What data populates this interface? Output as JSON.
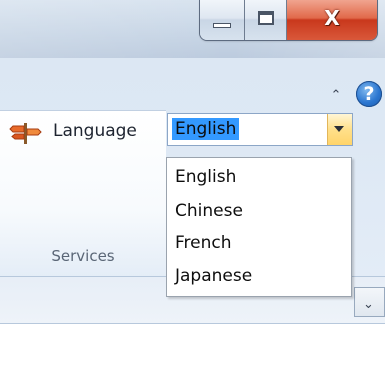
{
  "window": {
    "minimize_icon": "minimize-icon",
    "maximize_icon": "maximize-icon",
    "close_label": "X"
  },
  "ribbon": {
    "collapse_icon": "chevron-up-icon",
    "help_label": "?",
    "group": {
      "label": "Services",
      "language": {
        "icon": "signpost-icon",
        "label": "Language",
        "value": "English",
        "options": [
          "English",
          "Chinese",
          "French",
          "Japanese"
        ]
      }
    }
  },
  "colors": {
    "selection": "#3399ff",
    "arrow_highlight": "#ffe08a",
    "close_red": "#d9583a",
    "help_blue": "#2b76d0"
  }
}
